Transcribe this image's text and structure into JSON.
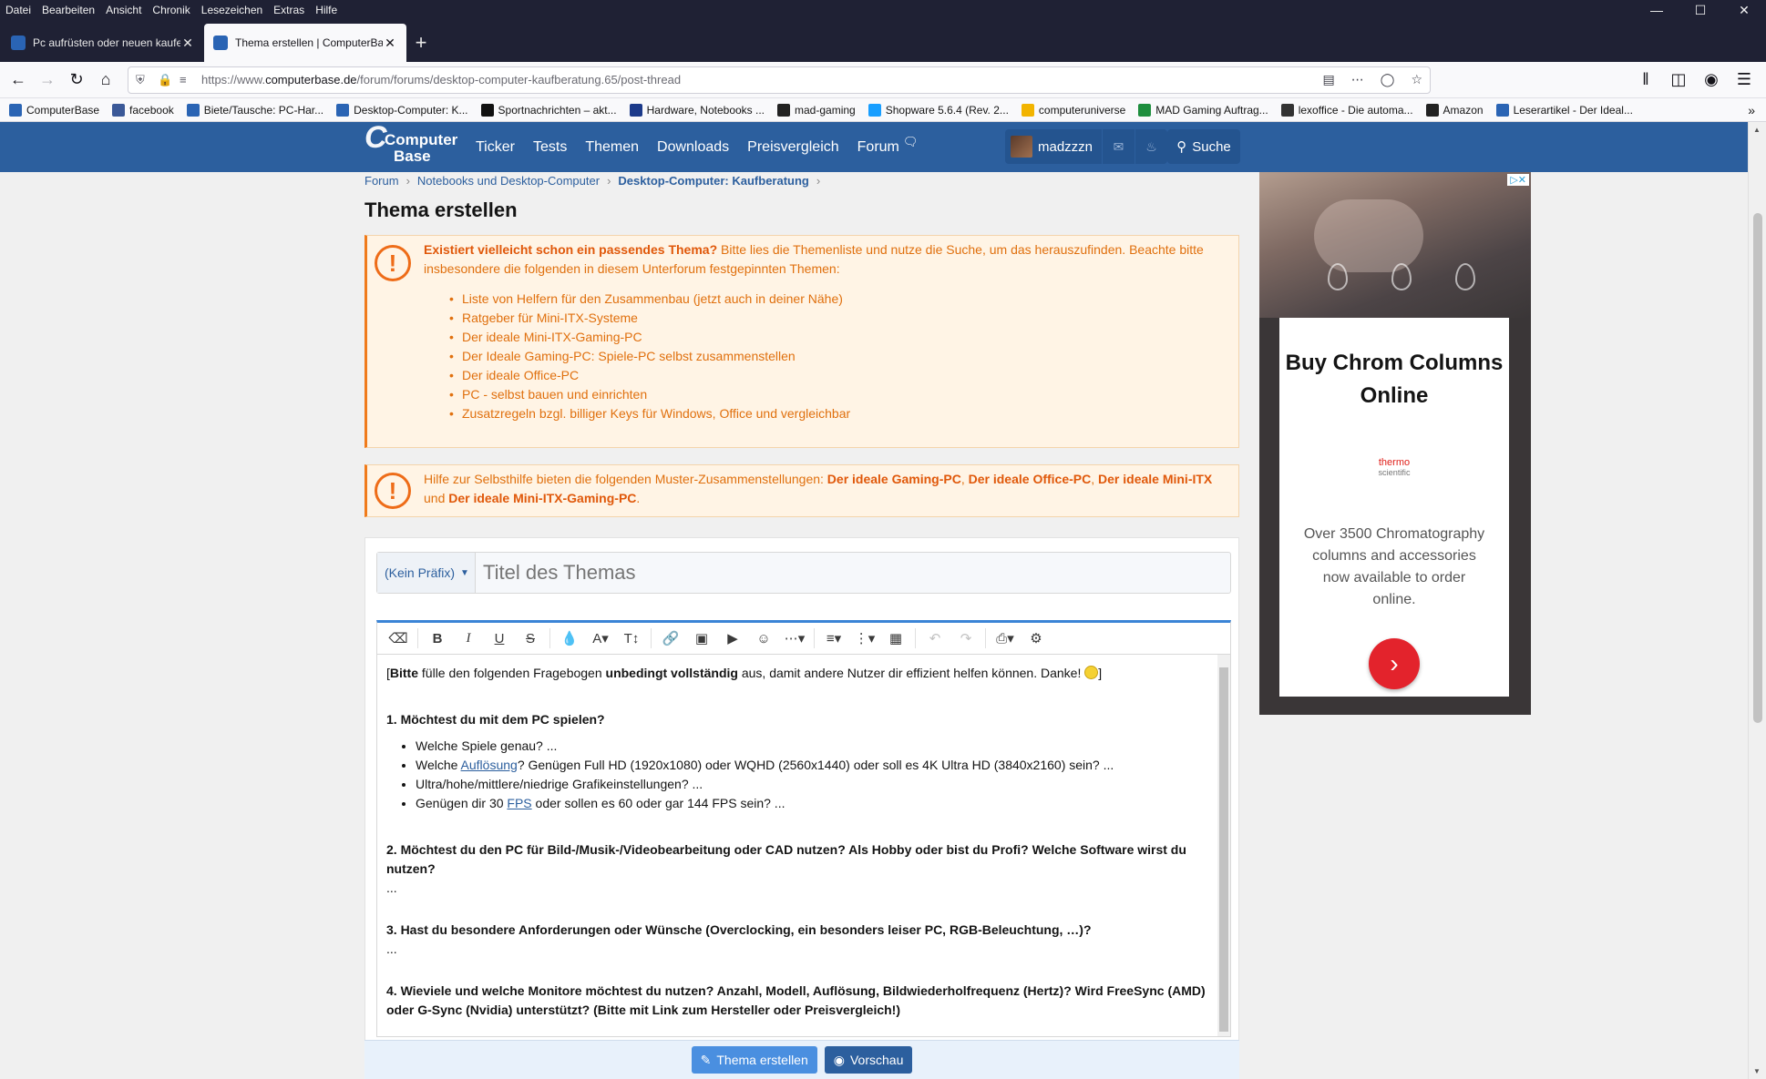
{
  "menubar": [
    "Datei",
    "Bearbeiten",
    "Ansicht",
    "Chronik",
    "Lesezeichen",
    "Extras",
    "Hilfe"
  ],
  "tabs": [
    {
      "title": "Pc aufrüsten oder neuen kaufe",
      "active": false
    },
    {
      "title": "Thema erstellen | ComputerBa",
      "active": true
    }
  ],
  "url": {
    "prefix": "https://www.",
    "domain": "computerbase.de",
    "path": "/forum/forums/desktop-computer-kaufberatung.65/post-thread"
  },
  "bookmarks": [
    {
      "label": "ComputerBase",
      "color": "#2a64b4"
    },
    {
      "label": "facebook",
      "color": "#3b5998"
    },
    {
      "label": "Biete/Tausche: PC-Har...",
      "color": "#2a64b4"
    },
    {
      "label": "Desktop-Computer: K...",
      "color": "#2a64b4"
    },
    {
      "label": "Sportnachrichten – akt...",
      "color": "#111111"
    },
    {
      "label": "Hardware, Notebooks ...",
      "color": "#1c3a8a"
    },
    {
      "label": "mad-gaming",
      "color": "#222222"
    },
    {
      "label": "Shopware 5.6.4 (Rev. 2...",
      "color": "#189eff"
    },
    {
      "label": "computeruniverse",
      "color": "#f2b400"
    },
    {
      "label": "MAD Gaming Auftrag...",
      "color": "#1e8e3e"
    },
    {
      "label": "lexoffice - Die automa...",
      "color": "#333333"
    },
    {
      "label": "Amazon",
      "color": "#222222"
    },
    {
      "label": "Leserartikel - Der Ideal...",
      "color": "#2a64b4"
    }
  ],
  "site": {
    "logo_line1": "Computer",
    "logo_line2": "Base",
    "logo_initial": "C",
    "nav": [
      "Ticker",
      "Tests",
      "Themen",
      "Downloads",
      "Preisvergleich",
      "Forum"
    ],
    "username": "madzzzn",
    "search_label": "Suche"
  },
  "breadcrumb": [
    "Forum",
    "Notebooks und Desktop-Computer",
    "Desktop-Computer: Kaufberatung"
  ],
  "page_title": "Thema erstellen",
  "notice1": {
    "lead_bold": "Existiert vielleicht schon ein passendes Thema?",
    "t1": " Bitte lies die ",
    "link1": "Themenliste",
    "t2": " und nutze die ",
    "link2": "Suche",
    "t3": ", um das herauszufinden. Beachte bitte insbesondere die folgenden in diesem Unterforum festgepinnten Themen:",
    "items": [
      "Liste von Helfern für den Zusammenbau (jetzt auch in deiner Nähe)",
      "Ratgeber für Mini-ITX-Systeme",
      "Der ideale Mini-ITX-Gaming-PC",
      "Der Ideale Gaming-PC: Spiele-PC selbst zusammenstellen",
      "Der ideale Office-PC",
      "PC - selbst bauen und einrichten",
      "Zusatzregeln bzgl. billiger Keys für Windows, Office und vergleichbar"
    ]
  },
  "notice2": {
    "t1": "Hilfe zur Selbsthilfe bieten die folgenden Muster-Zusammenstellungen: ",
    "b1": "Der ideale Gaming-PC",
    "c1": ", ",
    "b2": "Der ideale Office-PC",
    "c2": ", ",
    "b3": "Der ideale Mini-ITX",
    "t2": " und ",
    "b4": "Der ideale Mini-ITX-Gaming-PC",
    "t3": "."
  },
  "form": {
    "prefix": "(Kein Präfix)",
    "title_placeholder": "Titel des Themas"
  },
  "editor": {
    "intro_open": "[",
    "intro_b1": "Bitte",
    "intro_t1": " fülle den folgenden Fragebogen ",
    "intro_b2": "unbedingt vollständig",
    "intro_t2": " aus, damit andere Nutzer dir effizient helfen können. Danke! ",
    "intro_close": "]",
    "q1": "1. Möchtest du mit dem PC spielen?",
    "q1_items": {
      "a": "Welche Spiele genau? ...",
      "b_pre": "Welche ",
      "b_link": "Auflösung",
      "b_post": "? Genügen Full HD (1920x1080) oder WQHD (2560x1440) oder soll es 4K Ultra HD (3840x2160) sein? ...",
      "c": "Ultra/hohe/mittlere/niedrige Grafikeinstellungen? ...",
      "d_pre": "Genügen dir 30 ",
      "d_link": "FPS",
      "d_post": " oder sollen es 60 oder gar 144 FPS sein? ..."
    },
    "q2": "2. Möchtest du den PC für Bild-/Musik-/Videobearbeitung oder CAD nutzen? Als Hobby oder bist du Profi? Welche Software wirst du nutzen?",
    "q3": "3. Hast du besondere Anforderungen oder Wünsche (Overclocking, ein besonders leiser PC, RGB-Beleuchtung, …)?",
    "q4": "4. Wieviele und welche Monitore möchtest du nutzen? Anzahl, Modell, Auflösung, Bildwiederholfrequenz (Hertz)? Wird FreeSync (AMD) oder G-Sync (Nvidia) unterstützt? (Bitte mit Link zum Hersteller oder Preisvergleich!)",
    "ellipsis": "..."
  },
  "buttons": {
    "submit": "Thema erstellen",
    "preview": "Vorschau"
  },
  "ad": {
    "headline": "Buy Chrom Columns Online",
    "brand_line1": "thermo",
    "brand_line2": "scientific",
    "description": "Over 3500 Chromatography columns and accessories now available to order online.",
    "cta_icon": "arrow-right-icon"
  },
  "colors": {
    "site_blue": "#2c5f9e",
    "notice_orange": "#ee6c18",
    "ad_red": "#e3232c"
  }
}
